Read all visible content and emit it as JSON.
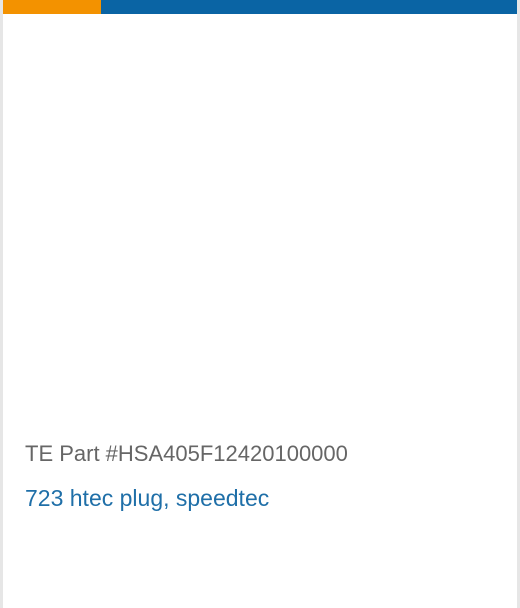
{
  "colors": {
    "accent_orange": "#f39200",
    "accent_blue": "#0a64a4",
    "link": "#1f6fa8",
    "muted_text": "#666666"
  },
  "product": {
    "part_number": "TE Part #HSA405F12420100000",
    "name": "723 htec plug, speedtec"
  }
}
